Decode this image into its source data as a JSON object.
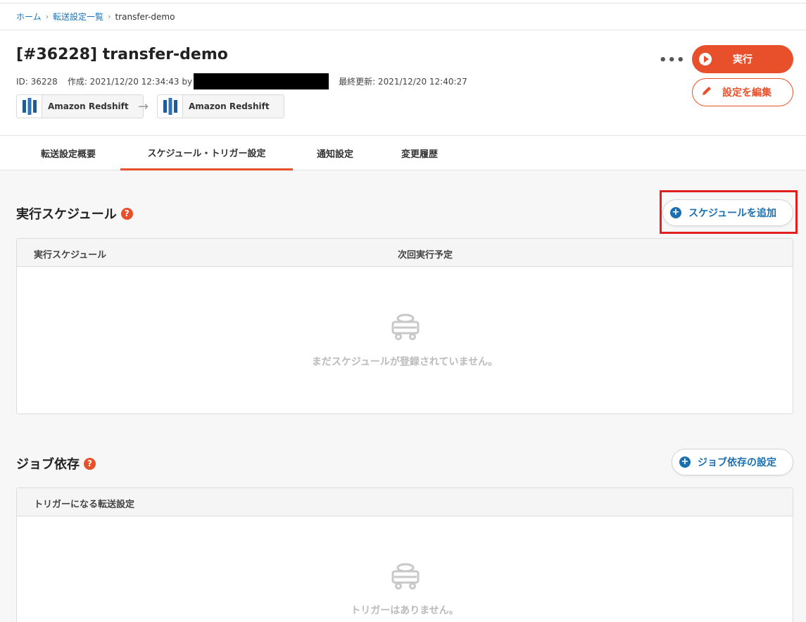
{
  "breadcrumb": {
    "home": "ホーム",
    "list": "転送設定一覧",
    "current": "transfer-demo"
  },
  "header": {
    "title": "[#36228] transfer-demo",
    "id_text": "ID: 36228",
    "created_text": "作成: 2021/12/20 12:34:43 by",
    "updated_text": "最終更新: 2021/12/20 12:40:27",
    "source": "Amazon Redshift",
    "destination": "Amazon Redshift",
    "more_label": "•••",
    "run_label": "実行",
    "edit_label": "設定を編集"
  },
  "tabs": [
    {
      "label": "転送設定概要"
    },
    {
      "label": "スケジュール・トリガー設定"
    },
    {
      "label": "通知設定"
    },
    {
      "label": "変更履歴"
    }
  ],
  "schedule": {
    "title": "実行スケジュール",
    "add_label": "スケジュールを追加",
    "col1": "実行スケジュール",
    "col2": "次回実行予定",
    "empty": "まだスケジュールが登録されていません。"
  },
  "jobdep": {
    "title": "ジョブ依存",
    "add_label": "ジョブ依存の設定",
    "col1": "トリガーになる転送設定",
    "empty": "トリガーはありません。"
  },
  "colors": {
    "accent": "#e8502b",
    "link": "#1a6fb0",
    "highlight": "#e02020"
  }
}
